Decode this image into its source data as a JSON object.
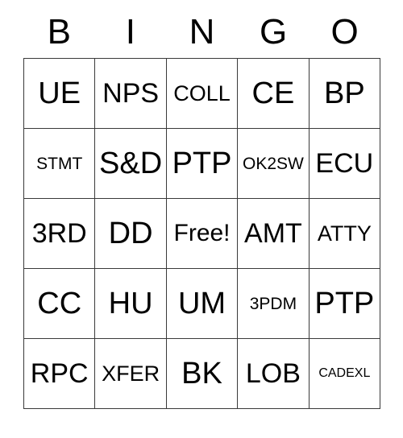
{
  "card": {
    "type": "bingo-card",
    "header": {
      "letters": [
        "B",
        "I",
        "N",
        "G",
        "O"
      ]
    },
    "grid": {
      "columns": 5,
      "rows": 5,
      "free_space": "Free!",
      "border_color": "#3a3a3a",
      "background_color": "#ffffff",
      "text_color": "#000000",
      "cells": [
        [
          {
            "label": "UE",
            "size": "sz-xl"
          },
          {
            "label": "NPS",
            "size": "sz-lg"
          },
          {
            "label": "COLL",
            "size": "sz-sm"
          },
          {
            "label": "CE",
            "size": "sz-xl"
          },
          {
            "label": "BP",
            "size": "sz-xl"
          }
        ],
        [
          {
            "label": "STMT",
            "size": "sz-xs"
          },
          {
            "label": "S&D",
            "size": "sz-xl"
          },
          {
            "label": "PTP",
            "size": "sz-xl"
          },
          {
            "label": "OK2SW",
            "size": "sz-xs"
          },
          {
            "label": "ECU",
            "size": "sz-lg"
          }
        ],
        [
          {
            "label": "3RD",
            "size": "sz-lg"
          },
          {
            "label": "DD",
            "size": "sz-xl"
          },
          {
            "label": "Free!",
            "size": "sz-md"
          },
          {
            "label": "AMT",
            "size": "sz-lg"
          },
          {
            "label": "ATTY",
            "size": "sz-sm"
          }
        ],
        [
          {
            "label": "CC",
            "size": "sz-xl"
          },
          {
            "label": "HU",
            "size": "sz-xl"
          },
          {
            "label": "UM",
            "size": "sz-xl"
          },
          {
            "label": "3PDM",
            "size": "sz-xs"
          },
          {
            "label": "PTP",
            "size": "sz-xl"
          }
        ],
        [
          {
            "label": "RPC",
            "size": "sz-lg"
          },
          {
            "label": "XFER",
            "size": "sz-sm"
          },
          {
            "label": "BK",
            "size": "sz-xl"
          },
          {
            "label": "LOB",
            "size": "sz-lg"
          },
          {
            "label": "CADEXL",
            "size": "sz-xxs"
          }
        ]
      ]
    }
  }
}
